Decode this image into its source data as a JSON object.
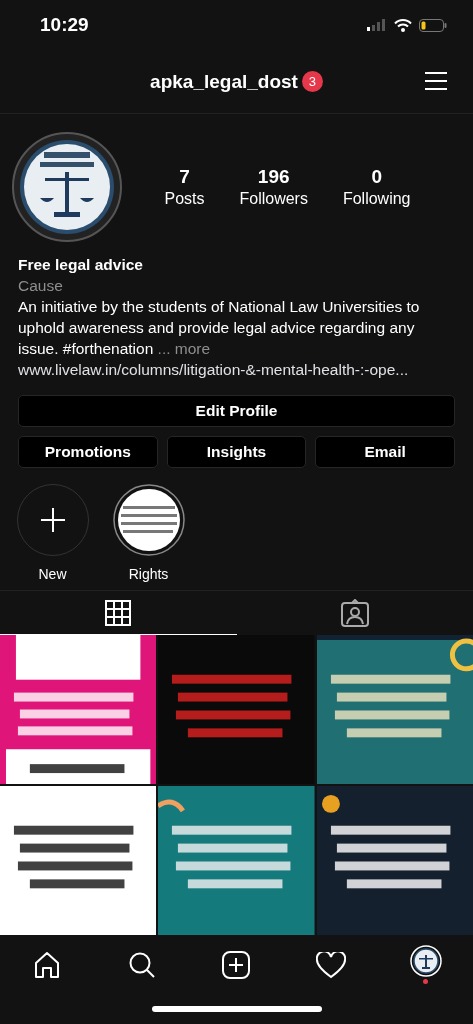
{
  "status_bar": {
    "time": "10:29"
  },
  "header": {
    "username": "apka_legal_dost",
    "notification_count": "3"
  },
  "profile": {
    "stats": [
      {
        "value": "7",
        "label": "Posts"
      },
      {
        "value": "196",
        "label": "Followers"
      },
      {
        "value": "0",
        "label": "Following"
      }
    ],
    "name": "Free legal advice",
    "category": "Cause",
    "bio": "An initiative by the students of National Law Universities to uphold awareness and provide legal advice regarding any issue. #forthenation",
    "more": "... more",
    "link": "www.livelaw.in/columns/litigation-&-mental-health-:-ope..."
  },
  "buttons": {
    "primary": "Edit Profile",
    "secondary": [
      "Promotions",
      "Insights",
      "Email"
    ]
  },
  "highlights": [
    {
      "kind": "new",
      "label": "New"
    },
    {
      "kind": "story",
      "label": "Rights"
    }
  ],
  "tabs": [
    {
      "kind": "grid",
      "selected": true
    },
    {
      "kind": "tagged",
      "selected": false
    }
  ],
  "bottom_nav": [
    {
      "kind": "home"
    },
    {
      "kind": "search"
    },
    {
      "kind": "add"
    },
    {
      "kind": "activity"
    },
    {
      "kind": "profile",
      "selected": true
    }
  ]
}
